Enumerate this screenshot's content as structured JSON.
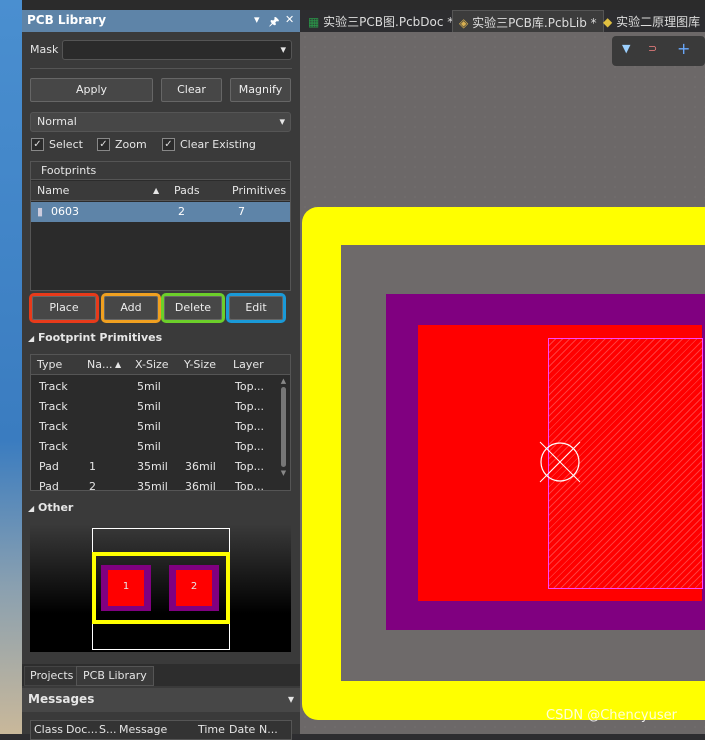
{
  "panel": {
    "title": "PCB Library",
    "mask_label": "Mask",
    "mask_value": "",
    "buttons": {
      "apply": "Apply",
      "clear": "Clear",
      "magnify": "Magnify"
    },
    "mode": "Normal",
    "checks": [
      {
        "label": "Select",
        "checked": true
      },
      {
        "label": "Zoom",
        "checked": true
      },
      {
        "label": "Clear Existing",
        "checked": true
      }
    ],
    "footprints": {
      "title": "Footprints",
      "columns": [
        "Name",
        "Pads",
        "Primitives"
      ],
      "rows": [
        {
          "name": "0603",
          "pads": "2",
          "primitives": "7"
        }
      ]
    },
    "actions": {
      "place": "Place",
      "add": "Add",
      "delete": "Delete",
      "edit": "Edit"
    },
    "action_highlight_colors": {
      "place": "#e83a1a",
      "add": "#f0a020",
      "delete": "#6ccf2a",
      "edit": "#1a9ad8"
    },
    "primitives": {
      "title": "Footprint Primitives",
      "columns": [
        "Type",
        "Na...",
        "X-Size",
        "Y-Size",
        "Layer"
      ],
      "rows": [
        [
          "Track",
          "",
          "5mil",
          "",
          "Top..."
        ],
        [
          "Track",
          "",
          "5mil",
          "",
          "Top..."
        ],
        [
          "Track",
          "",
          "5mil",
          "",
          "Top..."
        ],
        [
          "Track",
          "",
          "5mil",
          "",
          "Top..."
        ],
        [
          "Pad",
          "1",
          "35mil",
          "36mil",
          "Top..."
        ],
        [
          "Pad",
          "2",
          "35mil",
          "36mil",
          "Top..."
        ]
      ]
    },
    "other": {
      "title": "Other",
      "pad_labels": [
        "1",
        "2"
      ]
    },
    "bottom_tabs": [
      "Projects",
      "PCB Library"
    ],
    "messages": {
      "title": "Messages",
      "columns": [
        "Class",
        "Doc...",
        "S...",
        "Message",
        "Time",
        "Date",
        "N..."
      ]
    }
  },
  "doc_tabs": [
    {
      "label": "实验三PCB图.PcbDoc *",
      "active": false
    },
    {
      "label": "实验三PCB库.PcbLib *",
      "active": true
    },
    {
      "label": "实验二原理图库",
      "active": false
    }
  ],
  "watermark": "CSDN @Chencyuser"
}
